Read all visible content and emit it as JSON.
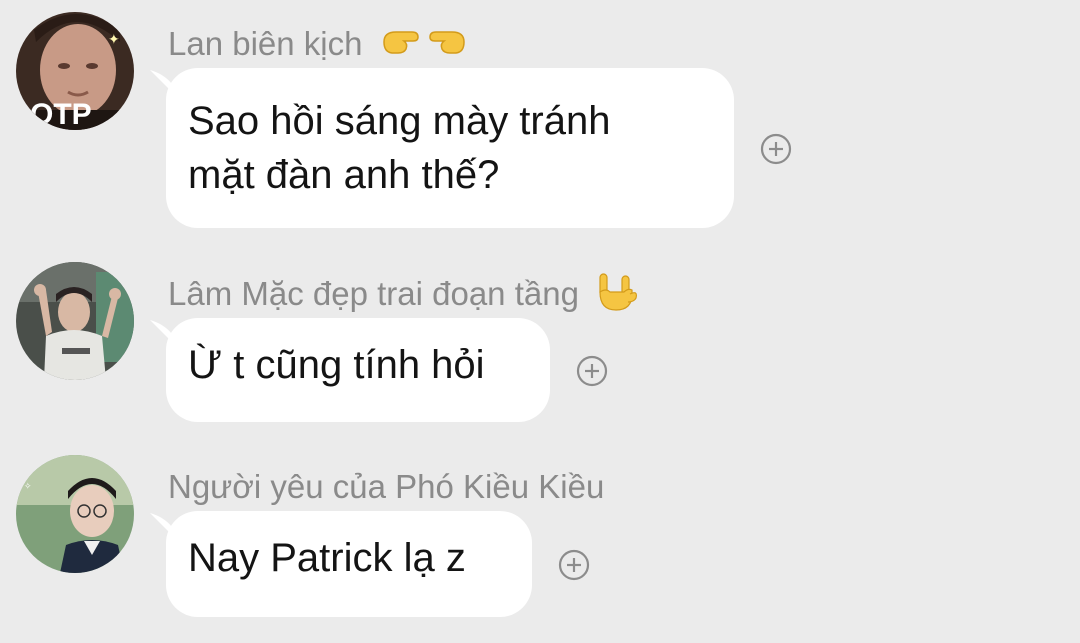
{
  "messages": [
    {
      "sender": "Lan biên kịch",
      "sender_emoji": "pointing-hands-emoji",
      "text_lines": [
        "Sao hồi sáng mày tránh",
        "mặt đàn anh thế?"
      ],
      "avatar_text": "OTP"
    },
    {
      "sender": "Lâm Mặc đẹp trai đoạn tầng",
      "sender_emoji": "rock-hand-emoji",
      "text_lines": [
        "Ừ t cũng tính hỏi"
      ]
    },
    {
      "sender": "Người yêu của Phó Kiều Kiều",
      "text_lines": [
        "Nay Patrick lạ z"
      ]
    }
  ],
  "colors": {
    "background": "#ebebeb",
    "bubble": "#ffffff",
    "sender_text": "#8a8a8a",
    "message_text": "#141414",
    "react_icon": "#8c8c8c"
  }
}
